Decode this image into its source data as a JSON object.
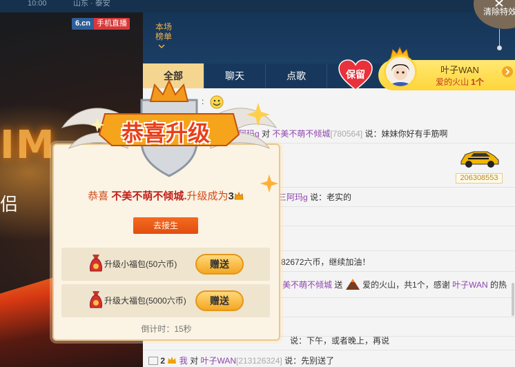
{
  "topbar": {
    "time_fragment": "10:00",
    "location_fragment": "山东 · 泰安"
  },
  "brand": {
    "logo": "6.cn",
    "mobile_live": "手机直播"
  },
  "rank_link": "本场榜单",
  "clear_effects": "清除特效",
  "tabs": [
    {
      "label": "全部"
    },
    {
      "label": "聊天"
    },
    {
      "label": "点歌"
    }
  ],
  "keep_button": "保留",
  "host": {
    "name": "叶子WAN",
    "sub": "爱的火山",
    "sub_count": "1个"
  },
  "stage": {
    "letters": "IM",
    "partial_text": "侣"
  },
  "chat": {
    "row1_user": "三阿玛g",
    "row1_mid": "对",
    "row1_target": "不美不萌不倾城",
    "row1_id": "[780564]",
    "row1_text": "说：妹妹你好有手筋啊",
    "row3_user": "三阿玛g",
    "row3_text": "说：老实的",
    "row4_text": "82672六币，继续加油！",
    "row5_target": "美不萌不倾城",
    "row5_mid": "送",
    "row5_gift": "爱的火山，共1个，感谢",
    "row5_host": "叶子WAN",
    "row5_tail": "的热",
    "row7_text": "说：下午，或者晚上，再说",
    "row8_level": "2",
    "row8_user": "我",
    "row8_mid": "对",
    "row8_target": "叶子WAN",
    "row8_id": "[213126324]",
    "row8_text": "说：先别送了",
    "car_number": "206308553"
  },
  "popup": {
    "banner_title": "恭喜升级",
    "congrats_prefix": "恭喜",
    "congrats_user": "不美不萌不倾城.",
    "congrats_mid": "升级成为",
    "congrats_level": "3",
    "visit_button": "去接生",
    "gifts": [
      {
        "label": "升级小福包(50六币)",
        "button": "赠送"
      },
      {
        "label": "升级大福包(5000六币)",
        "button": "赠送"
      }
    ],
    "countdown_label": "倒计时：",
    "countdown_value": "15秒"
  },
  "colors": {
    "accent_orange": "#e8551a",
    "gold": "#ffd53a",
    "header_blue": "#17385c",
    "username_purple": "#8e44ad"
  }
}
